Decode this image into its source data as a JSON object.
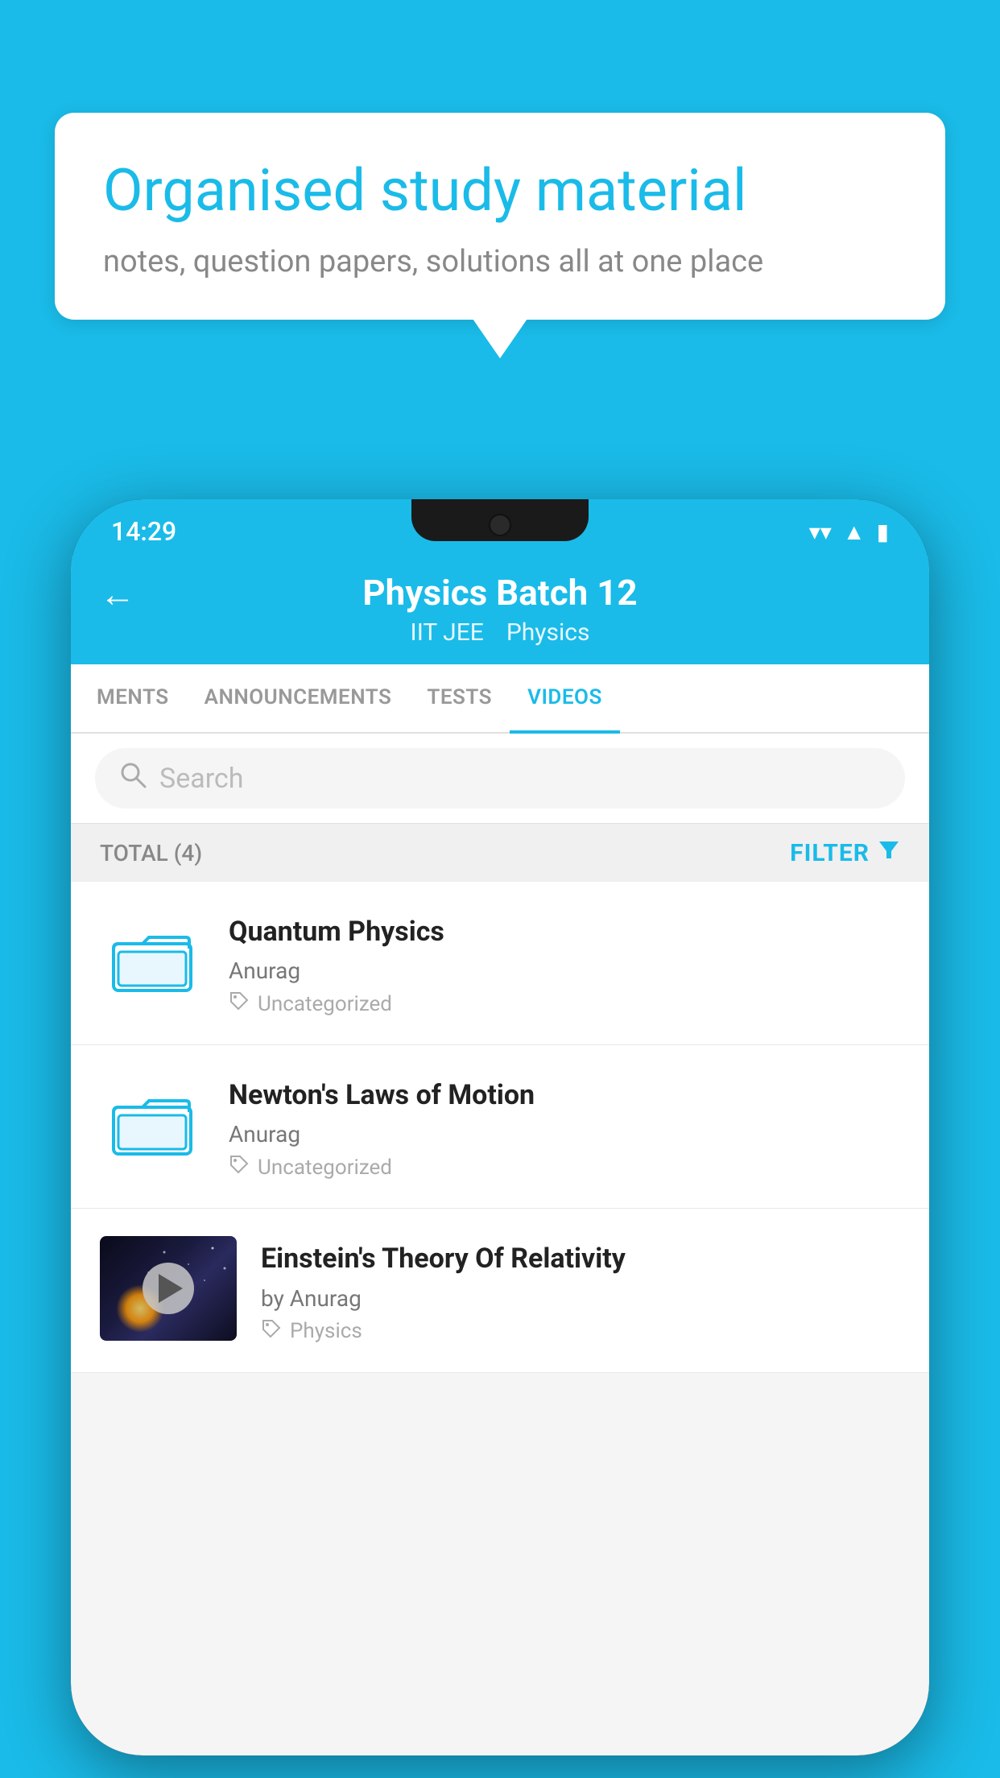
{
  "background_color": "#1ABBE8",
  "speech_bubble": {
    "title": "Organised study material",
    "subtitle": "notes, question papers, solutions all at one place"
  },
  "phone": {
    "status_bar": {
      "time": "14:29",
      "icons": [
        "wifi",
        "signal",
        "battery"
      ]
    },
    "header": {
      "back_label": "←",
      "title": "Physics Batch 12",
      "tags": [
        "IIT JEE",
        "Physics"
      ]
    },
    "tabs": [
      {
        "label": "MENTS",
        "active": false
      },
      {
        "label": "ANNOUNCEMENTS",
        "active": false
      },
      {
        "label": "TESTS",
        "active": false
      },
      {
        "label": "VIDEOS",
        "active": true
      }
    ],
    "search": {
      "placeholder": "Search"
    },
    "filter_bar": {
      "total_label": "TOTAL (4)",
      "filter_btn": "FILTER"
    },
    "videos": [
      {
        "id": 1,
        "title": "Quantum Physics",
        "author": "Anurag",
        "tag": "Uncategorized",
        "has_thumbnail": false
      },
      {
        "id": 2,
        "title": "Newton's Laws of Motion",
        "author": "Anurag",
        "tag": "Uncategorized",
        "has_thumbnail": false
      },
      {
        "id": 3,
        "title": "Einstein's Theory Of Relativity",
        "author_prefix": "by",
        "author": "Anurag",
        "tag": "Physics",
        "has_thumbnail": true
      }
    ]
  }
}
